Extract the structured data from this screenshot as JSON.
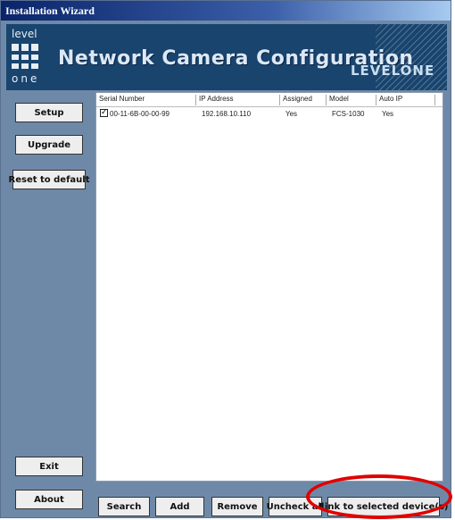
{
  "window": {
    "title": "Installation Wizard"
  },
  "banner": {
    "logo_top": "level",
    "logo_bottom": "one",
    "title": "Network Camera Configuration",
    "brand": "LEVELONE"
  },
  "sidebar": {
    "setup": "Setup",
    "upgrade": "Upgrade",
    "reset": "Reset to default",
    "exit": "Exit",
    "about": "About"
  },
  "table": {
    "columns": [
      "Serial Number",
      "IP Address",
      "Assigned",
      "Model",
      "Auto IP"
    ],
    "rows": [
      {
        "checked": true,
        "serial": "00-11-6B-00-00-99",
        "ip": "192.168.10.110",
        "assigned": "Yes",
        "model": "FCS-1030",
        "auto_ip": "Yes"
      }
    ]
  },
  "toolbar": {
    "search": "Search",
    "add": "Add",
    "remove": "Remove",
    "uncheck_all": "Uncheck all",
    "link": "Link to selected device(s)"
  },
  "highlight_color": "#e10000"
}
